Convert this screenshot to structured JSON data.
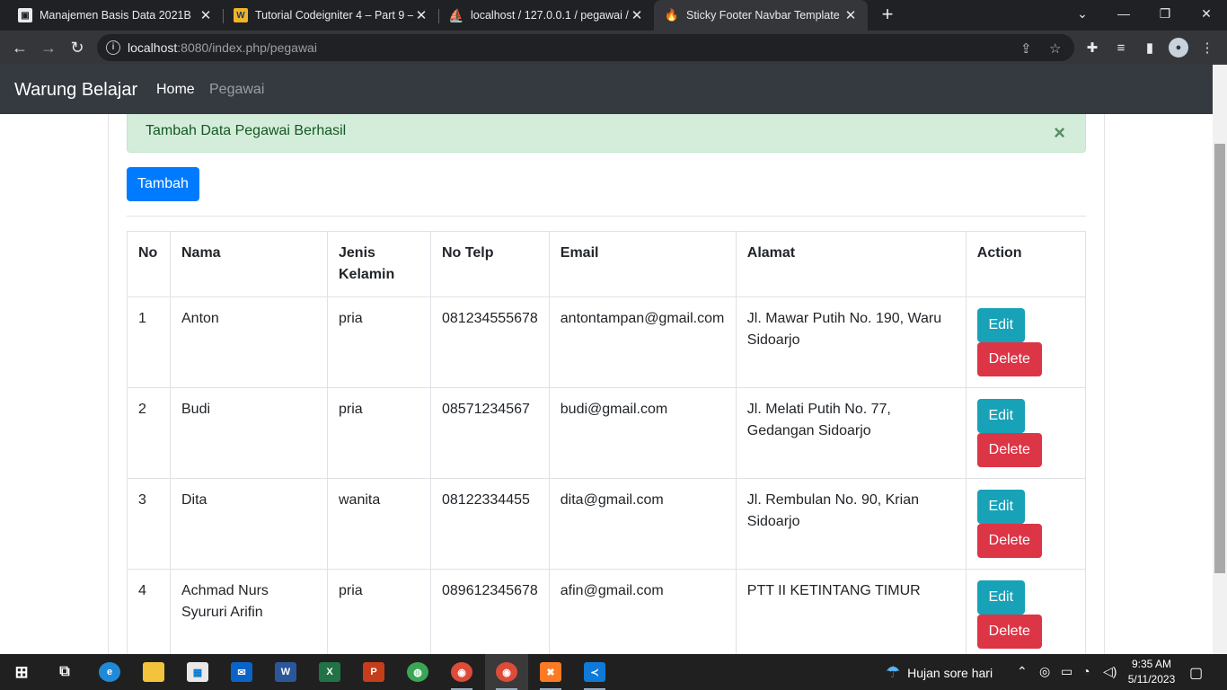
{
  "browser": {
    "tabs": [
      {
        "title": "Manajemen Basis Data 2021B",
        "active": false
      },
      {
        "title": "Tutorial Codeigniter 4 – Part 9 – ",
        "active": false
      },
      {
        "title": "localhost / 127.0.0.1 / pegawai / ",
        "active": false
      },
      {
        "title": "Sticky Footer Navbar Template · ",
        "active": true
      }
    ],
    "url_host": "localhost",
    "url_rest": ":8080/index.php/pegawai"
  },
  "navbar": {
    "brand": "Warung Belajar",
    "links": [
      "Home",
      "Pegawai"
    ]
  },
  "alert": {
    "message": "Tambah Data Pegawai Berhasil",
    "close": "×"
  },
  "add_button": "Tambah",
  "table": {
    "headers": [
      "No",
      "Nama",
      "Jenis Kelamin",
      "No Telp",
      "Email",
      "Alamat",
      "Action"
    ],
    "rows": [
      {
        "no": "1",
        "nama": "Anton",
        "jk": "pria",
        "telp": "081234555678",
        "email": "antontampan@gmail.com",
        "alamat": "Jl. Mawar Putih No. 190, Waru Sidoarjo"
      },
      {
        "no": "2",
        "nama": "Budi",
        "jk": "pria",
        "telp": "08571234567",
        "email": "budi@gmail.com",
        "alamat": "Jl. Melati Putih No. 77, Gedangan Sidoarjo"
      },
      {
        "no": "3",
        "nama": "Dita",
        "jk": "wanita",
        "telp": "08122334455",
        "email": "dita@gmail.com",
        "alamat": "Jl. Rembulan No. 90, Krian Sidoarjo"
      },
      {
        "no": "4",
        "nama": "Achmad Nurs Syururi Arifin",
        "jk": "pria",
        "telp": "089612345678",
        "email": "afin@gmail.com",
        "alamat": "PTT II KETINTANG TIMUR"
      }
    ],
    "edit_label": "Edit",
    "delete_label": "Delete"
  },
  "taskbar": {
    "weather": "Hujan sore hari",
    "time": "9:35 AM",
    "date": "5/11/2023"
  },
  "colors": {
    "navbar": "#343a40",
    "primary": "#007bff",
    "info": "#17a2b8",
    "danger": "#dc3545",
    "alert_bg": "#d4edda"
  }
}
